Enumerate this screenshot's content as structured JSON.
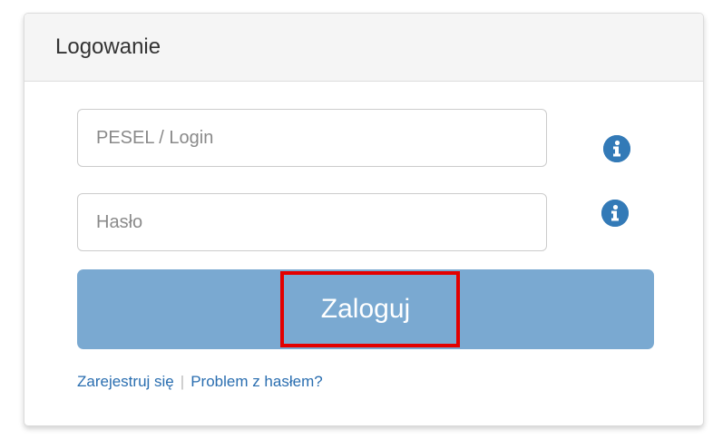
{
  "panel": {
    "title": "Logowanie"
  },
  "form": {
    "login_placeholder": "PESEL / Login",
    "login_value": "",
    "password_placeholder": "Hasło",
    "password_value": "",
    "login_info_icon": "info-circle",
    "password_info_icon": "info-circle",
    "submit_label": "Zaloguj"
  },
  "links": {
    "register": "Zarejestruj się",
    "separator": "|",
    "password_problem": "Problem z hasłem?"
  },
  "colors": {
    "button_bg": "#7aa9d1",
    "info_icon": "#337ab7",
    "link": "#2a6eb0",
    "highlight": "#e30000"
  }
}
